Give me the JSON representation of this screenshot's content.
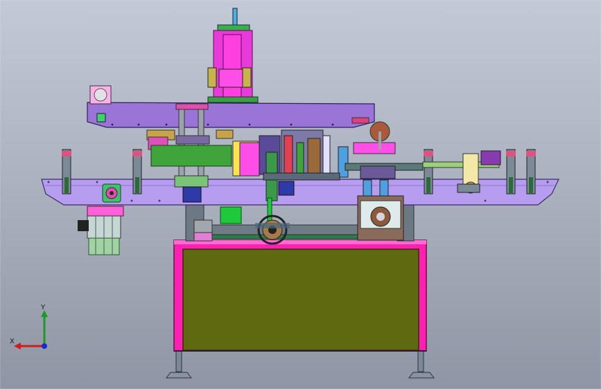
{
  "viewport": {
    "background_top": "#c3c9d6",
    "background_bottom": "#8e95a4"
  },
  "triad": {
    "x_label": "X",
    "y_label": "Y",
    "x_axis_color": "#d11a1a",
    "y_axis_color": "#1a9a2a",
    "z_axis_color": "#1a2ad1"
  },
  "colors": {
    "frame_pink": "#ff1fb0",
    "cabinet_olive": "#5f6a10",
    "plate_lavender": "#b79df0",
    "beam_purple": "#9a74d6",
    "motor_green": "#9fd3a0",
    "column_magenta": "#e83ad8"
  }
}
